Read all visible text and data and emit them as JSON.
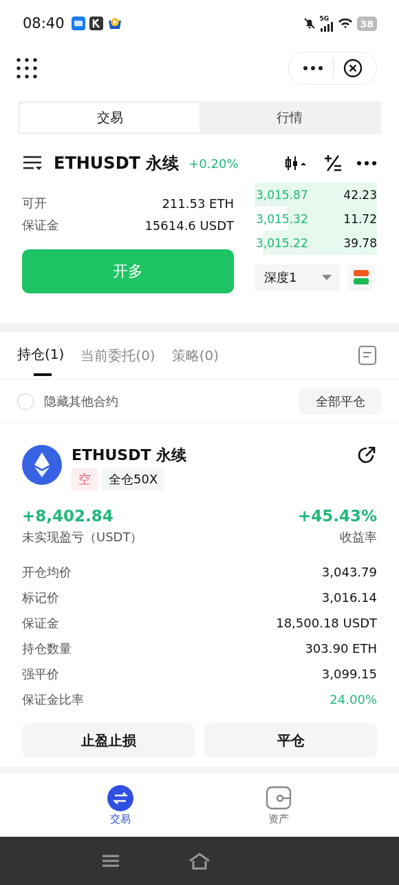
{
  "status_bar": {
    "time": "08:40",
    "network": "5G",
    "battery": "38"
  },
  "segments": [
    {
      "label": "交易",
      "selected": true
    },
    {
      "label": "行情",
      "selected": false
    }
  ],
  "ticker": {
    "symbol": "ETHUSDT 永续",
    "change": "+0.20%"
  },
  "order_info": [
    {
      "label": "可开",
      "value": "211.53 ETH"
    },
    {
      "label": "保证金",
      "value": "15614.6 USDT"
    }
  ],
  "open_button": "开多",
  "order_book": [
    {
      "price": "3,015.87",
      "amount": "42.23"
    },
    {
      "price": "3,015.32",
      "amount": "11.72"
    },
    {
      "price": "3,015.22",
      "amount": "39.78"
    }
  ],
  "depth_select": "深度1",
  "tabs": [
    {
      "label": "持仓(1)",
      "selected": true
    },
    {
      "label": "当前委托(0)",
      "selected": false
    },
    {
      "label": "策略(0)",
      "selected": false
    }
  ],
  "hide_others": {
    "label": "隐藏其他合约",
    "checked": false
  },
  "close_all_button": "全部平仓",
  "position": {
    "symbol": "ETHUSDT 永续",
    "side_tag": "空",
    "margin_tag": "全仓50X",
    "pnl": "+8,402.84",
    "pnl_label": "未实现盈亏（USDT）",
    "roe": "+45.43%",
    "roe_label": "收益率",
    "rows": [
      {
        "label": "开仓均价",
        "value": "3,043.79",
        "highlight": false
      },
      {
        "label": "标记价",
        "value": "3,016.14",
        "highlight": false
      },
      {
        "label": "保证金",
        "value": "18,500.18 USDT",
        "highlight": false
      },
      {
        "label": "持仓数量",
        "value": "303.90 ETH",
        "highlight": false
      },
      {
        "label": "强平价",
        "value": "3,099.15",
        "highlight": false
      },
      {
        "label": "保证金比率",
        "value": "24.00%",
        "highlight": true
      }
    ],
    "buttons": [
      "止盈止损",
      "平仓"
    ]
  },
  "bottom_nav": [
    {
      "label": "交易",
      "selected": true,
      "kind": "trade"
    },
    {
      "label": "资产",
      "selected": false,
      "kind": "wallet"
    }
  ]
}
